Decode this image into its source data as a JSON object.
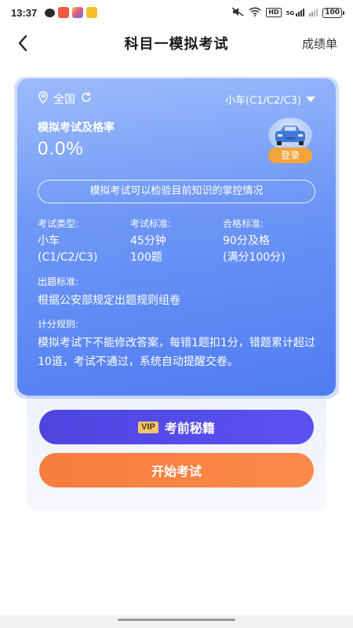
{
  "status_bar": {
    "time": "13:37",
    "net_badge": "HD",
    "signal_badge": "5G",
    "battery": "100"
  },
  "nav": {
    "title": "科目一模拟考试",
    "right_link": "成绩单"
  },
  "card": {
    "location": "全国",
    "car_type": "小车(C1/C2/C3)",
    "rate_label": "模拟考试及格率",
    "rate_value": "0.0%",
    "login_label": "登录",
    "tip": "模拟考试可以检验目前知识的掌控情况",
    "info": [
      {
        "key": "考试类型:",
        "value_line1": "小车",
        "value_line2": "(C1/C2/C3)"
      },
      {
        "key": "考试标准:",
        "value_line1": "45分钟",
        "value_line2": "100题"
      },
      {
        "key": "合格标准:",
        "value_line1": "90分及格",
        "value_line2": "(满分100分)"
      }
    ],
    "question_standard_label": "出题标准:",
    "question_standard_value": "根据公安部规定出题规则组卷",
    "scoring_label": "计分规则:",
    "scoring_value": "模拟考试下不能修改答案，每错1题扣1分，错题累计超过10道，考试不通过，系统自动提醒交卷。"
  },
  "buttons": {
    "vip_tag": "VIP",
    "vip_label": "考前秘籍",
    "start_label": "开始考试"
  },
  "colors": {
    "card_blue": "#5b87f4",
    "vip_button": "#5048e6",
    "start_button": "#f98445",
    "login_badge": "#f2a43a"
  }
}
